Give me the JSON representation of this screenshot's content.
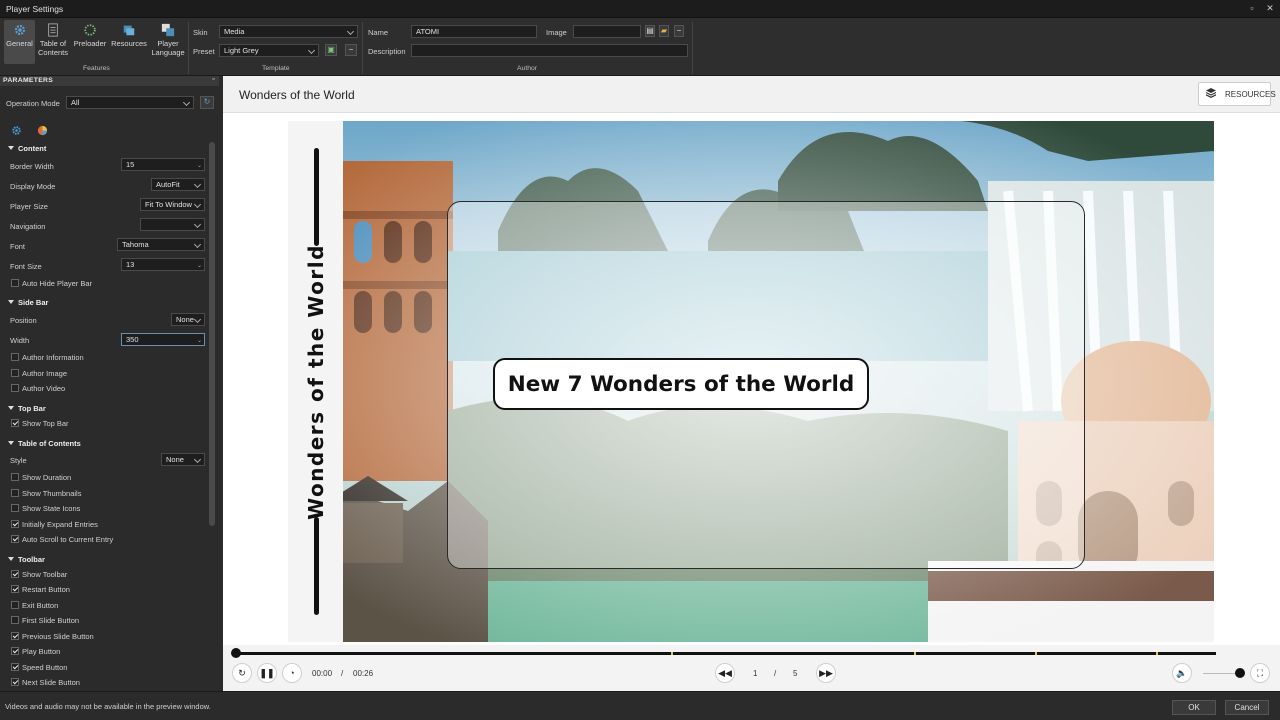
{
  "window": {
    "title": "Player Settings"
  },
  "ribbon": {
    "buttons": [
      {
        "label": "General"
      },
      {
        "label": "Table of\nContents"
      },
      {
        "label": "Preloader"
      },
      {
        "label": "Resources"
      },
      {
        "label": "Player\nLanguage"
      }
    ],
    "features_group": "Features",
    "template": {
      "skin_label": "Skin",
      "skin_value": "Media",
      "preset_label": "Preset",
      "preset_value": "Light Grey",
      "group": "Template"
    },
    "author": {
      "name_label": "Name",
      "name_value": "ATOMI",
      "image_label": "Image",
      "image_value": "",
      "description_label": "Description",
      "description_value": "",
      "group": "Author"
    }
  },
  "panel": {
    "header": "PARAMETERS",
    "operation_mode_label": "Operation Mode",
    "operation_mode_value": "All",
    "content": {
      "title": "Content",
      "border_width_label": "Border Width",
      "border_width_value": "15",
      "display_mode_label": "Display Mode",
      "display_mode_value": "AutoFit",
      "player_size_label": "Player Size",
      "player_size_value": "Fit To Window",
      "navigation_label": "Navigation",
      "navigation_value": "",
      "font_label": "Font",
      "font_value": "Tahoma",
      "font_size_label": "Font Size",
      "font_size_value": "13",
      "auto_hide_label": "Auto Hide Player Bar"
    },
    "sidebar": {
      "title": "Side Bar",
      "position_label": "Position",
      "position_value": "None",
      "width_label": "Width",
      "width_value": "350",
      "author_info": "Author Information",
      "author_image": "Author Image",
      "author_video": "Author Video"
    },
    "topbar": {
      "title": "Top Bar",
      "show_top_bar": "Show Top Bar"
    },
    "toc": {
      "title": "Table of Contents",
      "style_label": "Style",
      "style_value": "None",
      "show_duration": "Show Duration",
      "show_thumbnails": "Show Thumbnails",
      "show_state_icons": "Show State Icons",
      "initially_expand": "Initially Expand Entries",
      "auto_scroll": "Auto Scroll to Current Entry"
    },
    "toolbar": {
      "title": "Toolbar",
      "show_toolbar": "Show Toolbar",
      "restart": "Restart Button",
      "exit": "Exit Button",
      "first_slide": "First Slide Button",
      "previous_slide": "Previous Slide Button",
      "play": "Play Button",
      "speed": "Speed Button",
      "next_slide": "Next Slide Button"
    }
  },
  "preview": {
    "title": "Wonders of the World",
    "resources_button": "RESOURCES",
    "slide_vertical_title": "Wonders of the World",
    "slide_headline": "New 7 Wonders of the World",
    "time_current": "00:00",
    "time_sep": "/",
    "time_total": "00:26",
    "page_current": "1",
    "page_sep": "/",
    "page_total": "5",
    "progress": 0.0
  },
  "status": {
    "message": "Videos and audio may not be available in the preview window.",
    "ok": "OK",
    "cancel": "Cancel"
  },
  "colors": {
    "panel_bg": "#2b2b2b",
    "ribbon_bg": "#2e2e2e",
    "accent": "#4a90c2"
  }
}
